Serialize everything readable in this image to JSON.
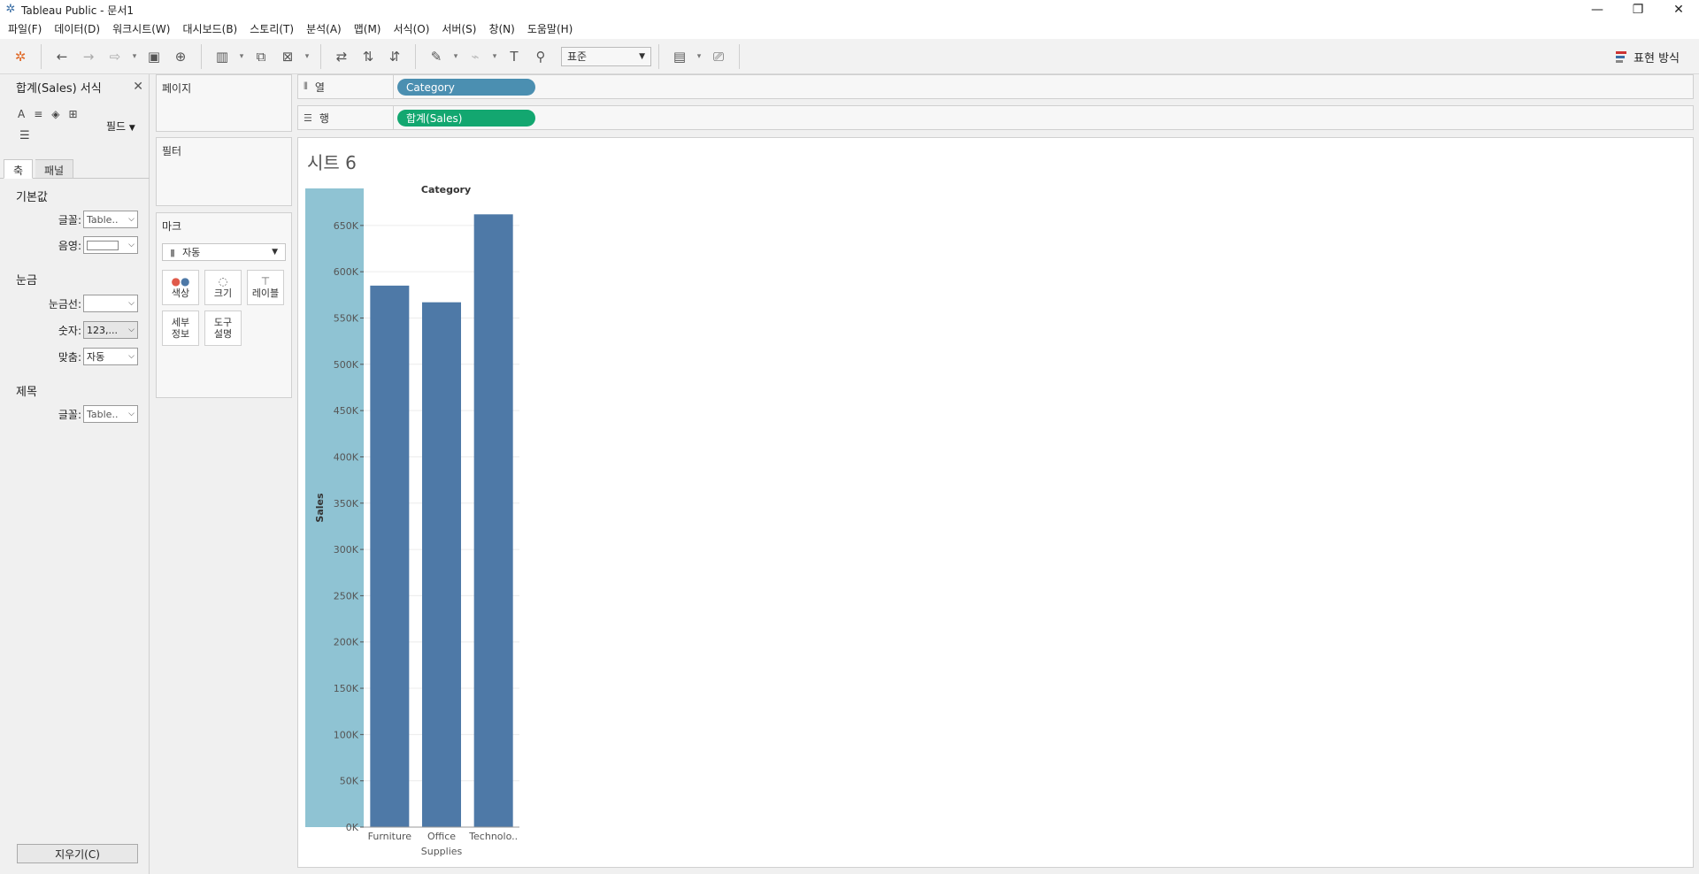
{
  "window": {
    "title": "Tableau Public - 문서1",
    "controls": {
      "minimize": "—",
      "restore": "❐",
      "close": "✕"
    }
  },
  "menu": [
    "파일(F)",
    "데이터(D)",
    "워크시트(W)",
    "대시보드(B)",
    "스토리(T)",
    "분석(A)",
    "맵(M)",
    "서식(O)",
    "서버(S)",
    "창(N)",
    "도움말(H)"
  ],
  "toolbar": {
    "fit_select": "표준",
    "show_me_label": "표현 방식"
  },
  "format_pane": {
    "title": "합계(Sales) 서식",
    "field_label": "필드",
    "tabs": [
      "축",
      "패널"
    ],
    "section_default": "기본값",
    "font_label": "글꼴:",
    "font_value": "Table..",
    "shading_label": "음영:",
    "section_ticks": "눈금",
    "gridlines_label": "눈금선:",
    "numbers_label": "숫자:",
    "numbers_value": "123,...",
    "align_label": "맞춤:",
    "align_value": "자동",
    "section_title": "제목",
    "title_font_label": "글꼴:",
    "title_font_value": "Table..",
    "clear_button": "지우기(C)"
  },
  "cards": {
    "pages": "페이지",
    "filters": "필터",
    "marks": "마크",
    "marks_type": "자동",
    "mark_buttons": {
      "color": "색상",
      "size": "크기",
      "label": "레이블",
      "detail_1": "세부",
      "detail_2": "정보",
      "tooltip_1": "도구",
      "tooltip_2": "설명"
    }
  },
  "shelves": {
    "columns_label": "열",
    "columns_pill": "Category",
    "rows_label": "행",
    "rows_pill": "합계(Sales)"
  },
  "sheet": {
    "title": "시트 6"
  },
  "colors": {
    "bar": "#4e79a7",
    "axis_highlight": "#8fc3d3",
    "dimension_pill": "#4b8fb1",
    "measure_pill": "#13a770"
  },
  "chart_data": {
    "type": "bar",
    "title": "",
    "xlabel": "Category",
    "ylabel": "Sales",
    "categories": [
      "Furniture",
      "Office Supplies",
      "Technology"
    ],
    "category_labels": [
      [
        "Furniture"
      ],
      [
        "Office",
        "Supplies"
      ],
      [
        "Technolo.."
      ]
    ],
    "values": [
      585000,
      567000,
      662000
    ],
    "ylim": [
      0,
      690000
    ],
    "yticks": [
      0,
      50000,
      100000,
      150000,
      200000,
      250000,
      300000,
      350000,
      400000,
      450000,
      500000,
      550000,
      600000,
      650000
    ],
    "ytick_labels": [
      "0K",
      "50K",
      "100K",
      "150K",
      "200K",
      "250K",
      "300K",
      "350K",
      "400K",
      "450K",
      "500K",
      "550K",
      "600K",
      "650K"
    ],
    "grid": true
  }
}
